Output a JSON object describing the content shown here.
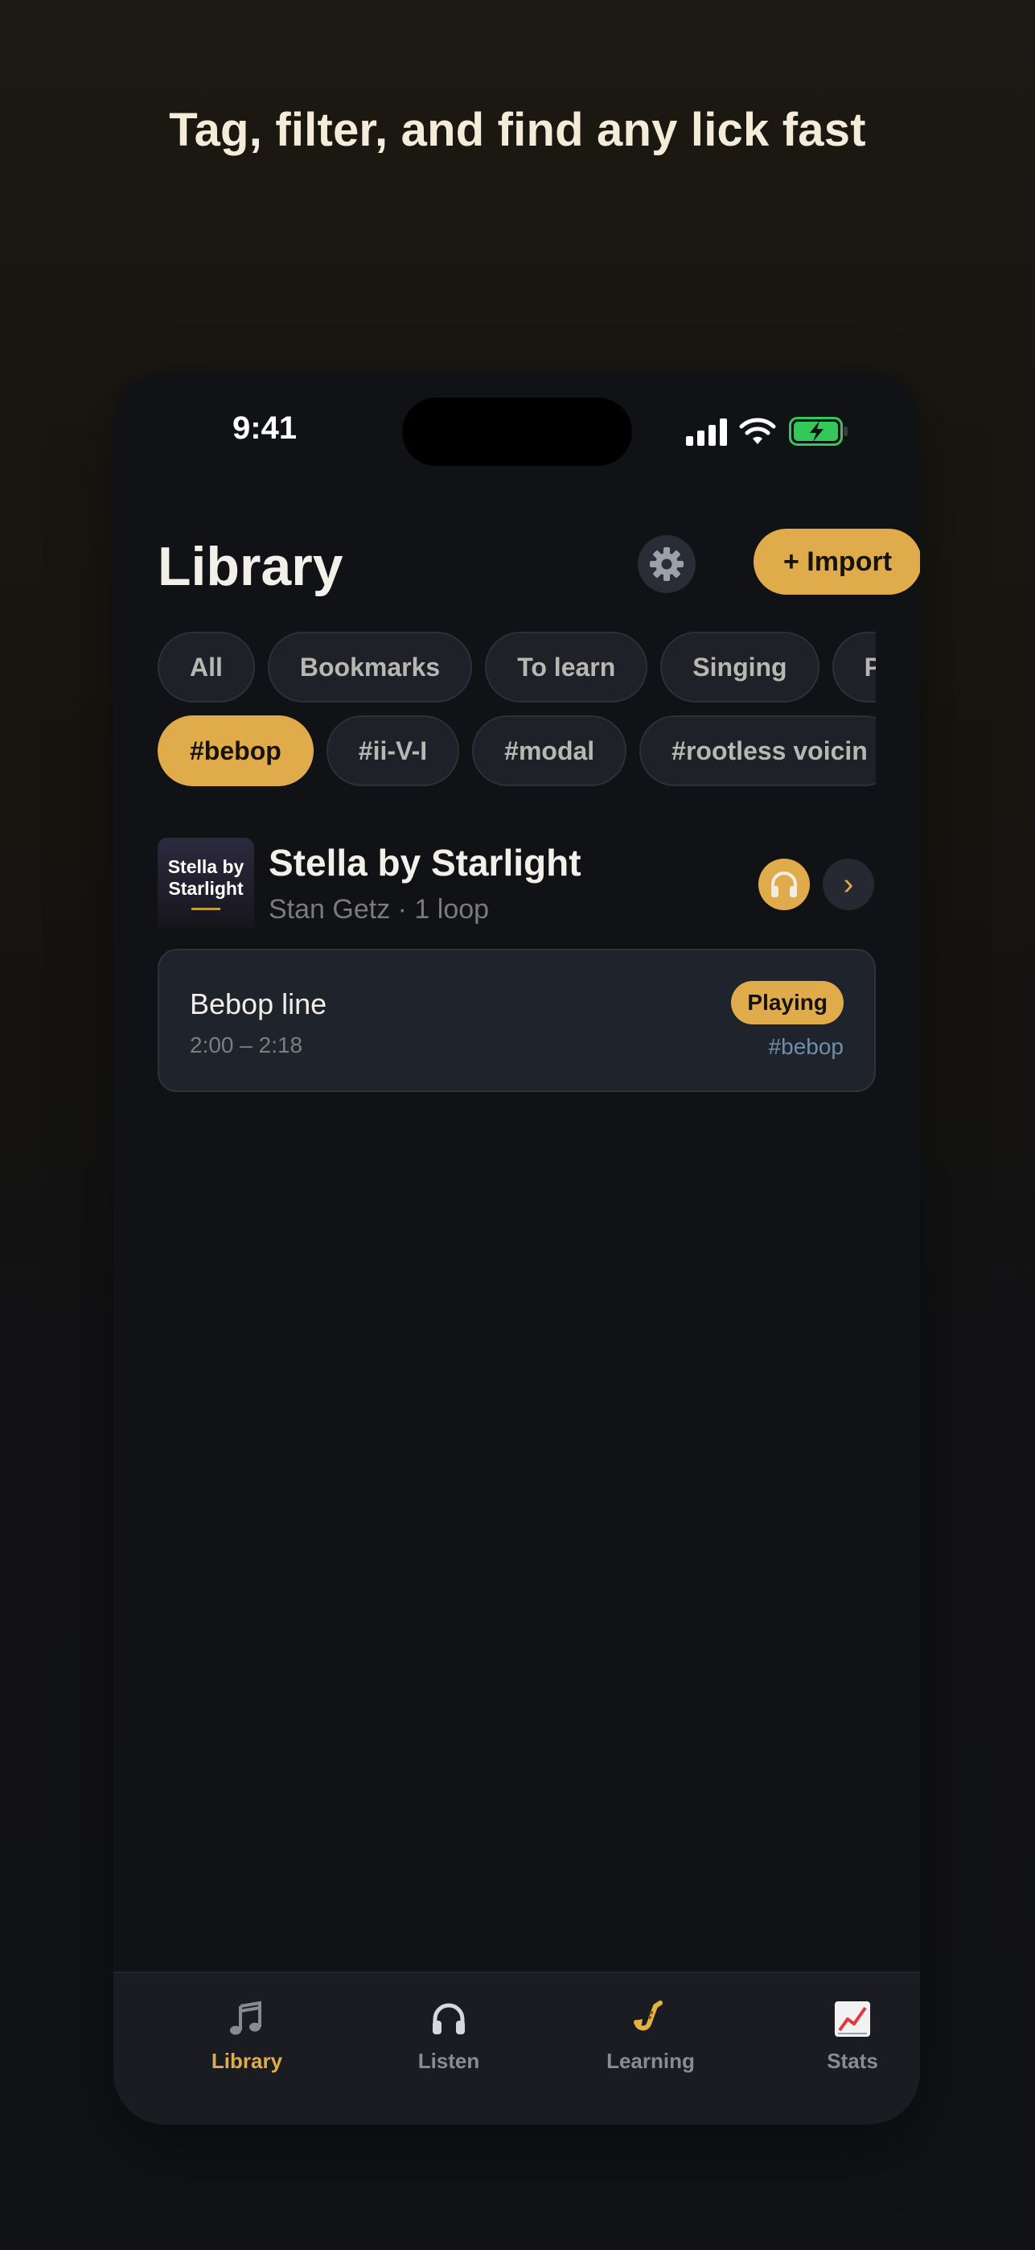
{
  "headline": "Tag, filter, and find any lick fast",
  "status_bar": {
    "time": "9:41"
  },
  "header": {
    "title": "Library",
    "import_label": "+ Import"
  },
  "filter_chips": [
    "All",
    "Bookmarks",
    "To learn",
    "Singing",
    "P"
  ],
  "tag_chips": [
    "#bebop",
    "#ii-V-I",
    "#modal",
    "#rootless voicin"
  ],
  "active_tag": "#bebop",
  "track": {
    "album_text": "Stella by Starlight",
    "title": "Stella by Starlight",
    "subtitle": "Stan Getz · 1 loop",
    "chevron": "›"
  },
  "loop": {
    "name": "Bebop line",
    "time_range": "2:00 – 2:18",
    "status_badge": "Playing",
    "tag": "#bebop"
  },
  "tabbar": {
    "tabs": [
      {
        "label": "Library",
        "icon": "music-note-icon",
        "active": true
      },
      {
        "label": "Listen",
        "icon": "headphones-icon",
        "active": false
      },
      {
        "label": "Learning",
        "icon": "saxophone-icon",
        "active": false
      },
      {
        "label": "Stats",
        "icon": "chart-icon",
        "active": false
      }
    ]
  },
  "colors": {
    "accent": "#e0ab4b",
    "background": "#111215",
    "chip_bg": "#1e2128",
    "tag_blue": "#6e8faa"
  }
}
